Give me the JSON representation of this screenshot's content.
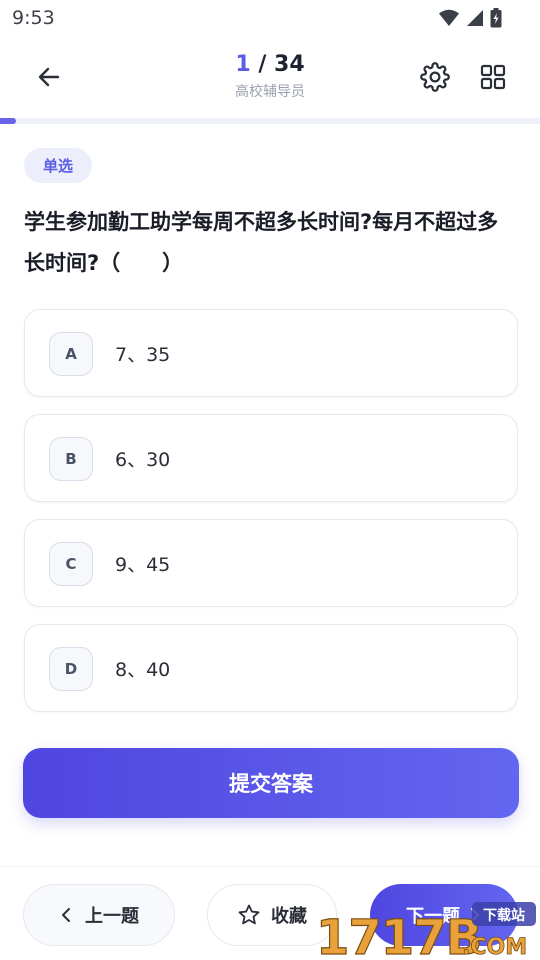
{
  "status_bar": {
    "time": "9:53"
  },
  "header": {
    "current": "1",
    "separator": " / ",
    "total": "34",
    "subtitle": "高校辅导员"
  },
  "progress": {
    "fraction": 0.0294
  },
  "question": {
    "type_label": "单选",
    "text": "学生参加勤工助学每周不超多长时间?每月不超过多长时间?（　　）"
  },
  "options": [
    {
      "letter": "A",
      "text": "7、35"
    },
    {
      "letter": "B",
      "text": "6、30"
    },
    {
      "letter": "C",
      "text": "9、45"
    },
    {
      "letter": "D",
      "text": "8、40"
    }
  ],
  "actions": {
    "submit_label": "提交答案",
    "prev_label": "上一题",
    "favorite_label": "收藏",
    "next_label": "下一题"
  },
  "watermark": {
    "text": "1717B.COM",
    "tag": "下载站"
  },
  "colors": {
    "accent": "#5a5ee6",
    "button_gradient_start": "#4f46e0",
    "button_gradient_end": "#6366f0"
  }
}
